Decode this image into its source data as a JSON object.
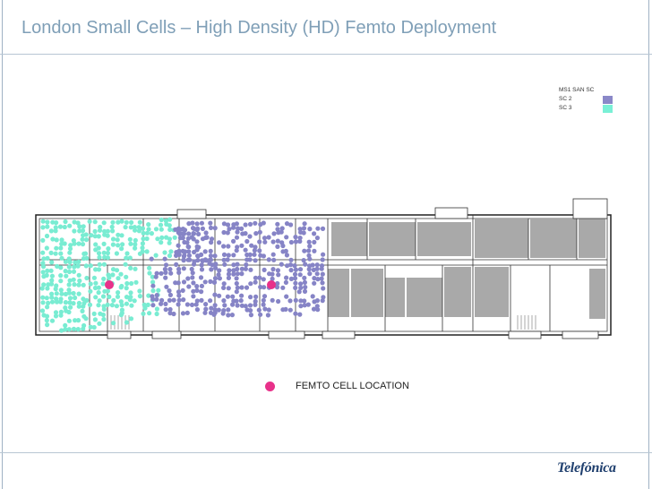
{
  "slide": {
    "title": "London Small Cells – High Density (HD) Femto Deployment"
  },
  "legend": {
    "items": [
      {
        "label": "MS1 SAN SC",
        "color": ""
      },
      {
        "label": "SC 2",
        "color": "#8a88c8"
      },
      {
        "label": "SC 3",
        "color": "#7af0d6"
      }
    ]
  },
  "floorplan": {
    "femto_cells": 2,
    "coverage_colors": {
      "sc2": "#8684c6",
      "sc3": "#79ecd2",
      "femto": "#e8318a"
    }
  },
  "femto_key": {
    "label": "FEMTO CELL LOCATION",
    "color": "#e8318a"
  },
  "logo": {
    "text": "Telefónica"
  }
}
